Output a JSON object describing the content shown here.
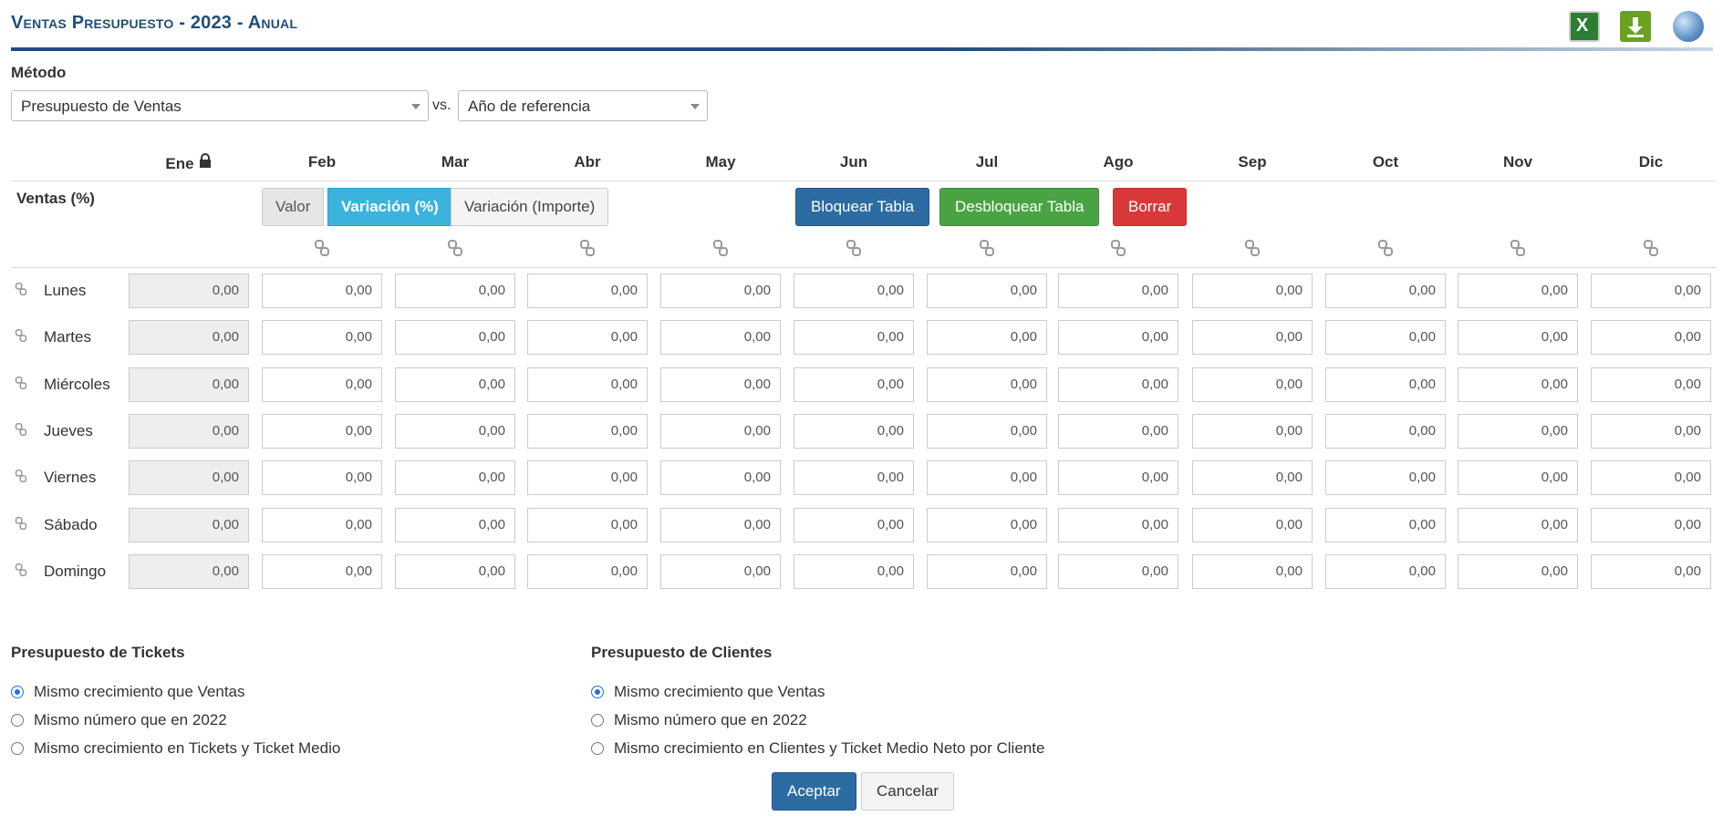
{
  "header": {
    "title": "Ventas Presupuesto - 2023 - Anual"
  },
  "toolbar_icons": [
    "excel-icon",
    "download-icon",
    "globe-icon"
  ],
  "method": {
    "label": "Método",
    "select_value": "Presupuesto de Ventas",
    "vs": "vs.",
    "reference_value": "Año de referencia"
  },
  "months": [
    "Ene",
    "Feb",
    "Mar",
    "Abr",
    "May",
    "Jun",
    "Jul",
    "Ago",
    "Sep",
    "Oct",
    "Nov",
    "Dic"
  ],
  "section_label": "Ventas (%)",
  "segment": [
    "Valor",
    "Variación (%)",
    "Variación (Importe)"
  ],
  "actions": {
    "lock": "Bloquear Tabla",
    "unlock": "Desbloquear Tabla",
    "delete": "Borrar"
  },
  "rows": [
    {
      "label": "Lunes",
      "values": [
        "0,00",
        "0,00",
        "0,00",
        "0,00",
        "0,00",
        "0,00",
        "0,00",
        "0,00",
        "0,00",
        "0,00",
        "0,00",
        "0,00"
      ]
    },
    {
      "label": "Martes",
      "values": [
        "0,00",
        "0,00",
        "0,00",
        "0,00",
        "0,00",
        "0,00",
        "0,00",
        "0,00",
        "0,00",
        "0,00",
        "0,00",
        "0,00"
      ]
    },
    {
      "label": "Miércoles",
      "values": [
        "0,00",
        "0,00",
        "0,00",
        "0,00",
        "0,00",
        "0,00",
        "0,00",
        "0,00",
        "0,00",
        "0,00",
        "0,00",
        "0,00"
      ]
    },
    {
      "label": "Jueves",
      "values": [
        "0,00",
        "0,00",
        "0,00",
        "0,00",
        "0,00",
        "0,00",
        "0,00",
        "0,00",
        "0,00",
        "0,00",
        "0,00",
        "0,00"
      ]
    },
    {
      "label": "Viernes",
      "values": [
        "0,00",
        "0,00",
        "0,00",
        "0,00",
        "0,00",
        "0,00",
        "0,00",
        "0,00",
        "0,00",
        "0,00",
        "0,00",
        "0,00"
      ]
    },
    {
      "label": "Sábado",
      "values": [
        "0,00",
        "0,00",
        "0,00",
        "0,00",
        "0,00",
        "0,00",
        "0,00",
        "0,00",
        "0,00",
        "0,00",
        "0,00",
        "0,00"
      ]
    },
    {
      "label": "Domingo",
      "values": [
        "0,00",
        "0,00",
        "0,00",
        "0,00",
        "0,00",
        "0,00",
        "0,00",
        "0,00",
        "0,00",
        "0,00",
        "0,00",
        "0,00"
      ]
    }
  ],
  "tickets": {
    "title": "Presupuesto de Tickets",
    "options": [
      "Mismo crecimiento que Ventas",
      "Mismo número que en 2022",
      "Mismo crecimiento en Tickets y Ticket Medio"
    ],
    "selected": 0
  },
  "clients": {
    "title": "Presupuesto de Clientes",
    "options": [
      "Mismo crecimiento que Ventas",
      "Mismo número que en 2022",
      "Mismo crecimiento en Clientes y Ticket Medio Neto por Cliente"
    ],
    "selected": 0
  },
  "footer": {
    "accept": "Aceptar",
    "cancel": "Cancelar"
  },
  "colors": {
    "title": "#1f4e79",
    "segment_active": "#3bb3dc",
    "lock_btn": "#2d6ca2",
    "unlock_btn": "#4aa343",
    "delete_btn": "#d9383a"
  }
}
